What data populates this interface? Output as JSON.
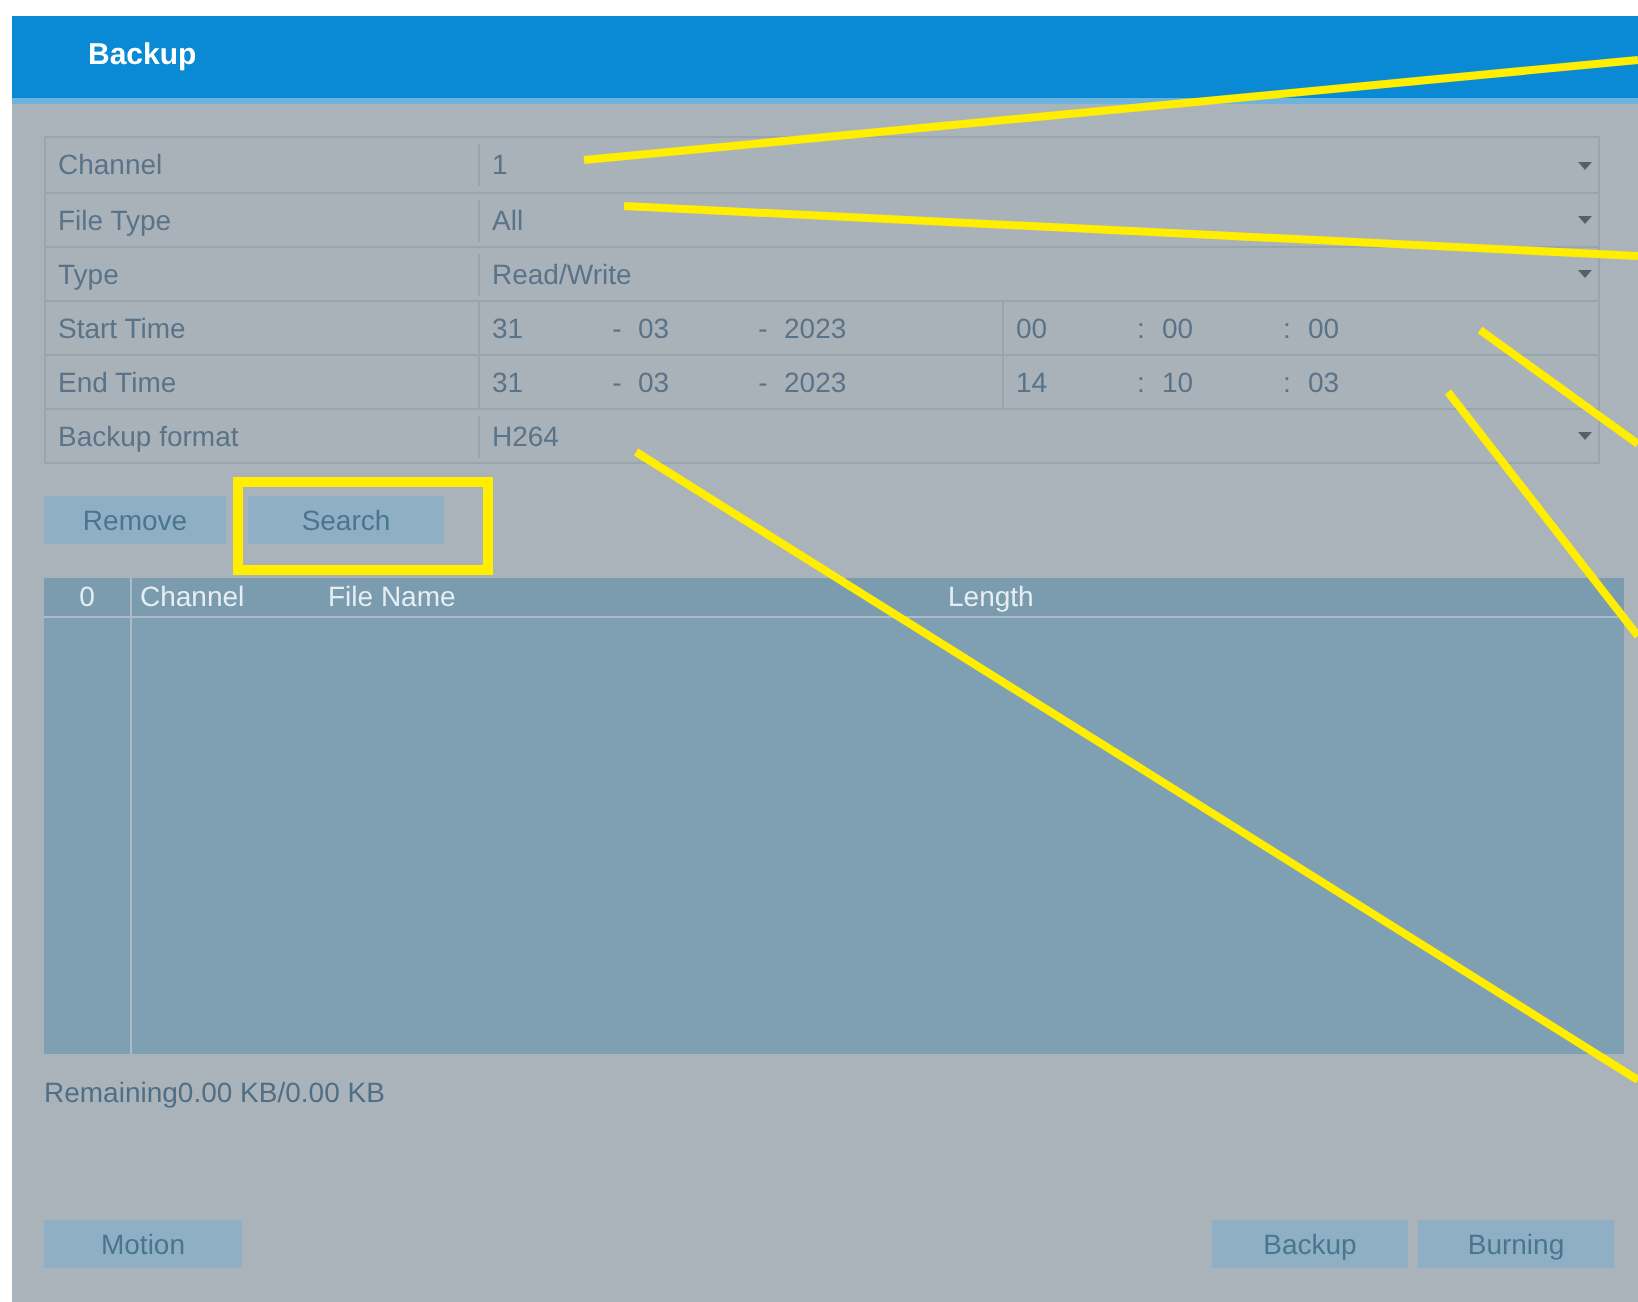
{
  "window": {
    "title": "Backup"
  },
  "form": [
    {
      "kind": "select",
      "label": "Channel",
      "value": "1"
    },
    {
      "kind": "select",
      "label": "File Type",
      "value": "All"
    },
    {
      "kind": "select",
      "label": "Type",
      "value": "Read/Write"
    },
    {
      "kind": "datetime",
      "label": "Start Time",
      "date": [
        "31",
        "-",
        "03",
        "-",
        "2023"
      ],
      "time": [
        "00",
        ":",
        "00",
        ":",
        "00"
      ]
    },
    {
      "kind": "datetime",
      "label": "End Time",
      "date": [
        "31",
        "-",
        "03",
        "-",
        "2023"
      ],
      "time": [
        "14",
        ":",
        "10",
        ":",
        "03"
      ]
    },
    {
      "kind": "select",
      "label": "Backup format",
      "value": "H264"
    }
  ],
  "actions": [
    "Remove",
    "Search"
  ],
  "table": {
    "columns": [
      "0",
      "Channel",
      "File Name",
      "Length"
    ]
  },
  "remaining": "Remaining0.00 KB/0.00 KB",
  "footer_left": [
    "Motion"
  ],
  "footer_right": [
    "Backup",
    "Burning"
  ]
}
